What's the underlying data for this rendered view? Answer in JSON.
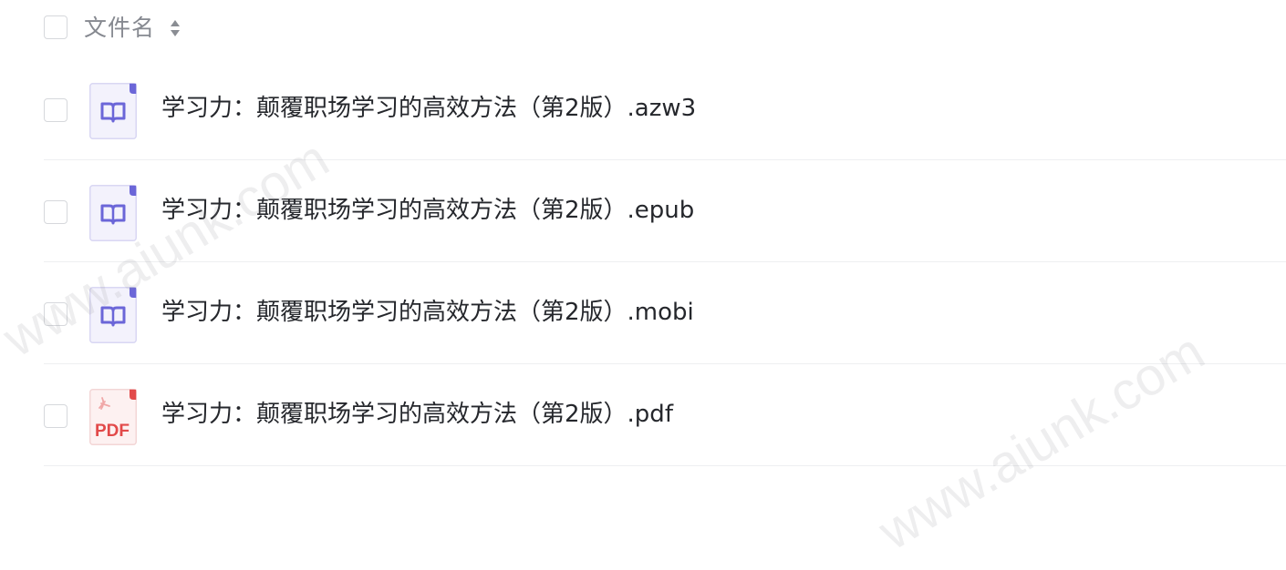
{
  "header": {
    "column_label": "文件名"
  },
  "files": [
    {
      "name": "学习力：颠覆职场学习的高效方法（第2版）.azw3",
      "icon": "ebook-icon"
    },
    {
      "name": "学习力：颠覆职场学习的高效方法（第2版）.epub",
      "icon": "ebook-icon"
    },
    {
      "name": "学习力：颠覆职场学习的高效方法（第2版）.mobi",
      "icon": "ebook-icon"
    },
    {
      "name": "学习力：颠覆职场学习的高效方法（第2版）.pdf",
      "icon": "pdf-icon",
      "icon_label": "PDF"
    }
  ],
  "watermark": {
    "text": "www.aiunk.com"
  },
  "colors": {
    "ebook_accent": "#6b66d8",
    "ebook_bg": "#f3f2fc",
    "pdf_accent": "#e24a4a",
    "pdf_bg": "#fdf1f1"
  }
}
